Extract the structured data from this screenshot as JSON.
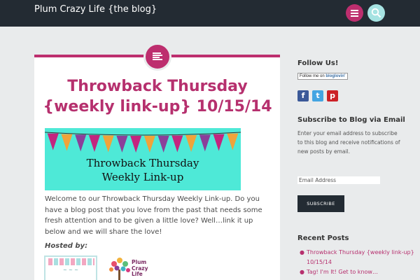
{
  "header": {
    "site_title": "Plum Crazy Life {the blog}",
    "menu_icon": "hamburger-menu-icon",
    "search_icon": "search-icon"
  },
  "post": {
    "format_icon": "document-lines-icon",
    "title_line1": "Throwback Thursday",
    "title_line2": "{weekly link-up} 10/15/14",
    "banner": {
      "line1": "Throwback Thursday",
      "line2": "Weekly Link-up",
      "pennant_colors": [
        "#c3257f",
        "#f0a33a",
        "#8b3f9a"
      ]
    },
    "body": "Welcome to our Throwback Thursday Weekly Link-up.  Do you have a blog post that you love from the past that needs some fresh attention and to be given a little love?  Well…link it up below and we will share the love!",
    "hosted_by": "Hosted by:",
    "host_logo_2_text": [
      "Plum",
      "Crazy",
      "Life"
    ]
  },
  "sidebar": {
    "follow_heading": "Follow Us!",
    "bloglovin_prefix": "Follow me on",
    "bloglovin_brand": "bloglovin'",
    "social": [
      {
        "icon": "facebook-icon",
        "glyph": "f"
      },
      {
        "icon": "twitter-icon",
        "glyph": "t"
      },
      {
        "icon": "pinterest-icon",
        "glyph": "p"
      }
    ],
    "subscribe_heading": "Subscribe to Blog via Email",
    "subscribe_desc": "Enter your email address to subscribe to this blog and receive notifications of new posts by email.",
    "email_placeholder": "Email Address",
    "subscribe_button": "SUBSCRIBE",
    "recent_heading": "Recent Posts",
    "recent_posts": [
      "Throwback Thursday {weekly link-up} 10/15/14",
      "Tag! I'm It! Get to know…"
    ]
  },
  "colors": {
    "accent": "#bd2e6e",
    "header_bg": "#232b33",
    "search_btn": "#a6e3e2",
    "banner_bg": "#4ee9d7"
  }
}
